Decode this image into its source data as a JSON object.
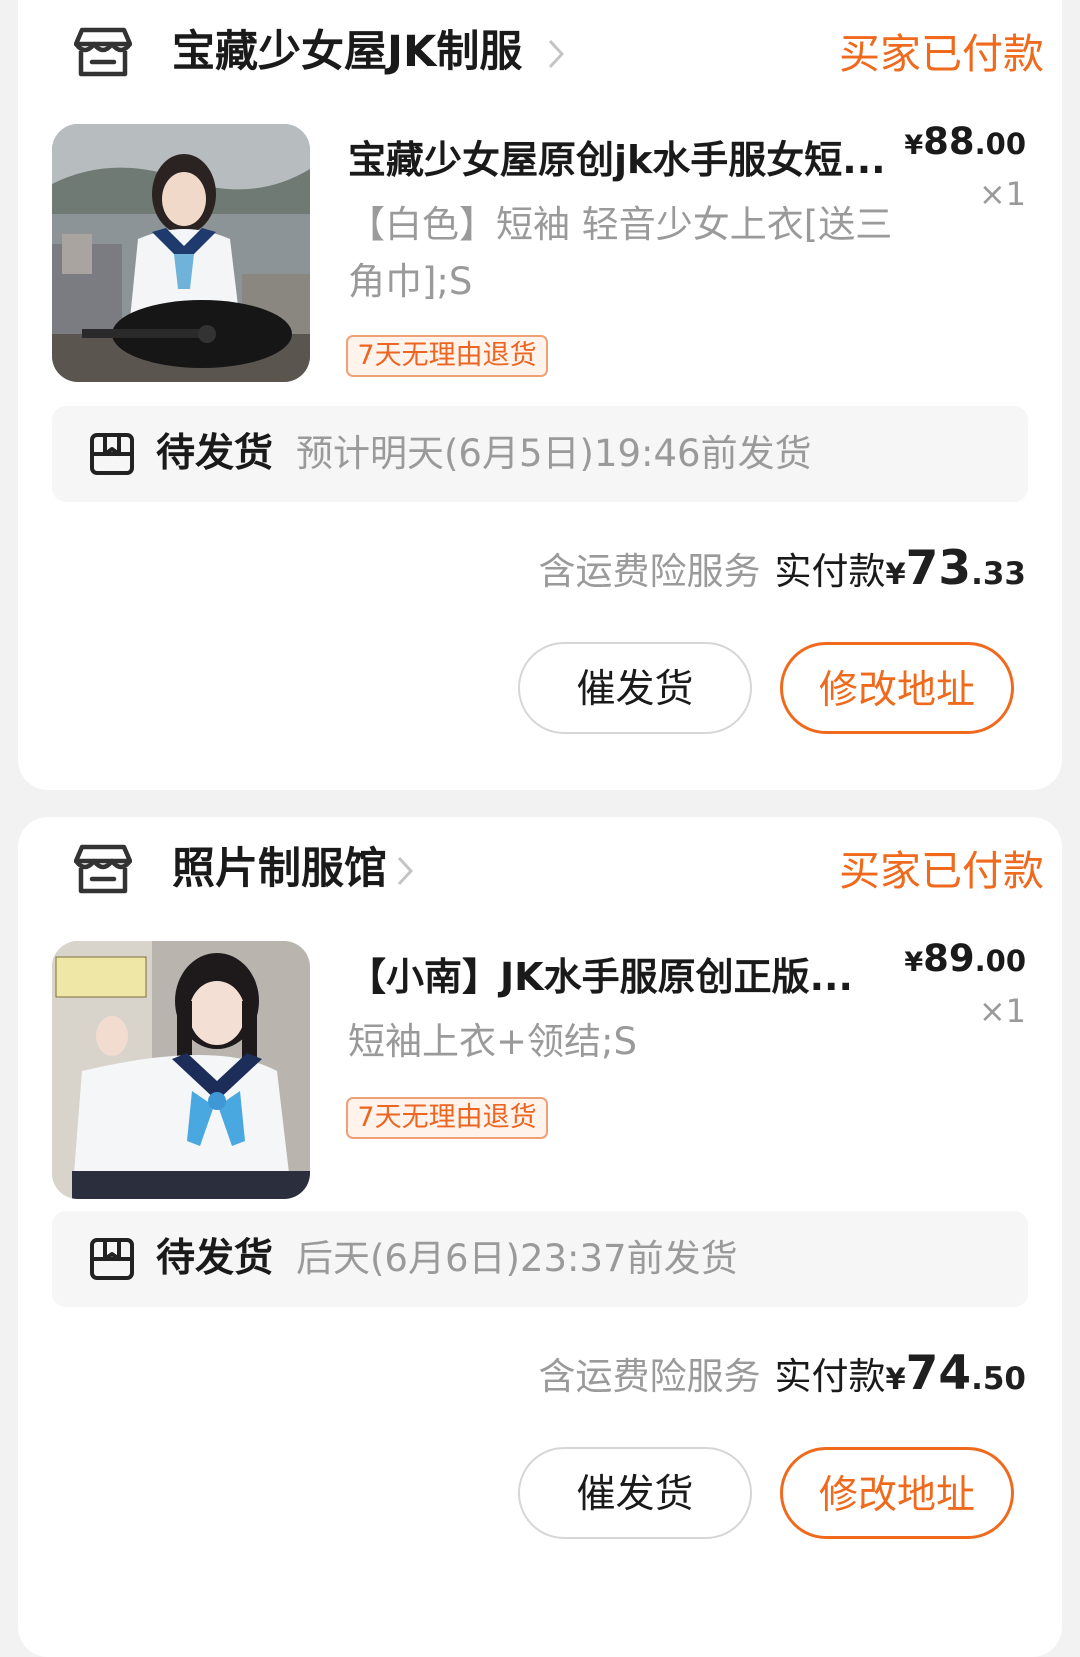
{
  "orders": [
    {
      "shop_name": "宝藏少女屋JK制服",
      "order_status": "买家已付款",
      "product": {
        "title": "宝藏少女屋原创jk水手服女短...",
        "spec": "【白色】短袖 轻音少女上衣[送三角巾];S",
        "price_currency": "¥",
        "price_int": "88",
        "price_dec": ".00",
        "quantity": "×1",
        "badge": "7天无理由退货"
      },
      "shipping": {
        "status": "待发货",
        "eta": "预计明天(6月5日)19:46前发货"
      },
      "payment": {
        "note": "含运费险服务",
        "label": "实付款",
        "currency": "¥",
        "int": "73",
        "dec": ".33"
      },
      "actions": {
        "urge": "催发货",
        "change_address": "修改地址"
      }
    },
    {
      "shop_name": "照片制服馆",
      "order_status": "买家已付款",
      "product": {
        "title": "【小南】JK水手服原创正版...",
        "spec": "短袖上衣+领结;S",
        "price_currency": "¥",
        "price_int": "89",
        "price_dec": ".00",
        "quantity": "×1",
        "badge": "7天无理由退货"
      },
      "shipping": {
        "status": "待发货",
        "eta": "后天(6月6日)23:37前发货"
      },
      "payment": {
        "note": "含运费险服务",
        "label": "实付款",
        "currency": "¥",
        "int": "74",
        "dec": ".50"
      },
      "actions": {
        "urge": "催发货",
        "change_address": "修改地址"
      }
    }
  ],
  "colors": {
    "accent": "#f06a1d",
    "muted_text": "#9a9a9a",
    "card_bg": "#ffffff",
    "page_bg": "#f2f2f2"
  },
  "icons": {
    "shop": "shop-icon",
    "chevron": "chevron-right-icon",
    "shipping": "package-icon"
  }
}
